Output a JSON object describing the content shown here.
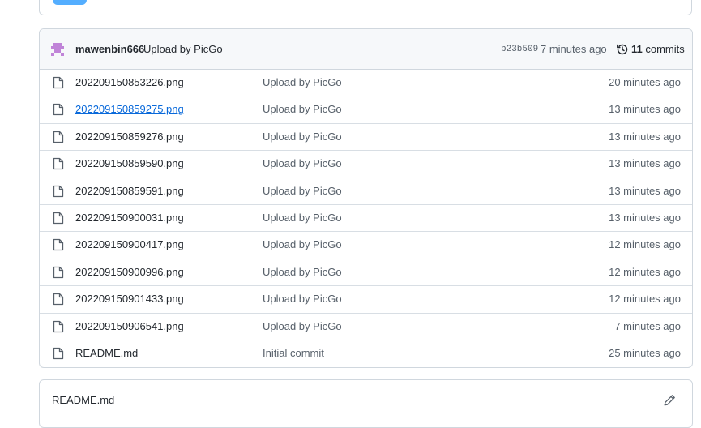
{
  "latest_commit": {
    "author": "mawenbin666",
    "message": "Upload by PicGo",
    "sha": "b23b509",
    "time": "7 minutes ago",
    "commit_count": "11",
    "commits_label": "commits",
    "avatar_icon": "identicon-avatar",
    "history_icon": "history-icon"
  },
  "files": [
    {
      "name": "202209150853226.png",
      "message": "Upload by PicGo",
      "time": "20 minutes ago",
      "icon": "file-icon"
    },
    {
      "name": "202209150859275.png",
      "message": "Upload by PicGo",
      "time": "13 minutes ago",
      "icon": "file-icon",
      "hovered": true
    },
    {
      "name": "202209150859276.png",
      "message": "Upload by PicGo",
      "time": "13 minutes ago",
      "icon": "file-icon"
    },
    {
      "name": "202209150859590.png",
      "message": "Upload by PicGo",
      "time": "13 minutes ago",
      "icon": "file-icon"
    },
    {
      "name": "202209150859591.png",
      "message": "Upload by PicGo",
      "time": "13 minutes ago",
      "icon": "file-icon"
    },
    {
      "name": "202209150900031.png",
      "message": "Upload by PicGo",
      "time": "13 minutes ago",
      "icon": "file-icon"
    },
    {
      "name": "202209150900417.png",
      "message": "Upload by PicGo",
      "time": "12 minutes ago",
      "icon": "file-icon"
    },
    {
      "name": "202209150900996.png",
      "message": "Upload by PicGo",
      "time": "12 minutes ago",
      "icon": "file-icon"
    },
    {
      "name": "202209150901433.png",
      "message": "Upload by PicGo",
      "time": "12 minutes ago",
      "icon": "file-icon"
    },
    {
      "name": "202209150906541.png",
      "message": "Upload by PicGo",
      "time": "7 minutes ago",
      "icon": "file-icon"
    },
    {
      "name": "README.md",
      "message": "Initial commit",
      "time": "25 minutes ago",
      "icon": "file-icon"
    }
  ],
  "readme": {
    "title": "README.md",
    "edit_icon": "pencil-icon"
  },
  "colors": {
    "link": "#0969da",
    "header_bg": "#f6f8fa",
    "border": "#d0d7de",
    "muted_text": "#57606a",
    "avatar": "#c084d8",
    "top_button": "#54aeff"
  }
}
